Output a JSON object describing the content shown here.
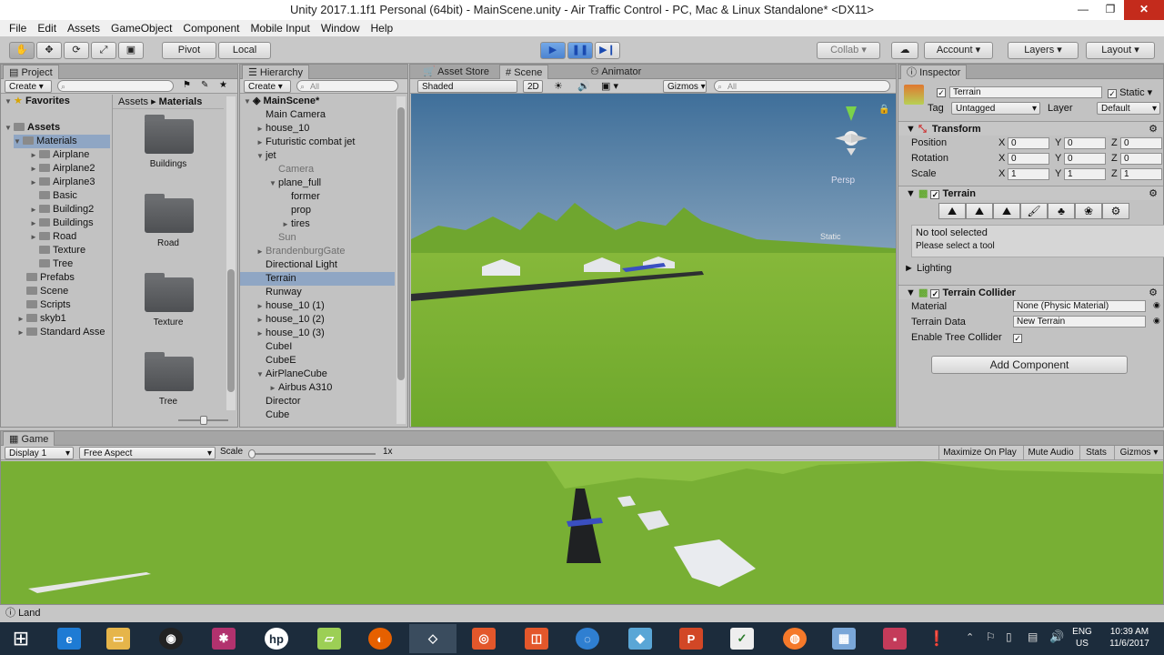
{
  "window": {
    "title": "Unity 2017.1.1f1 Personal (64bit) - MainScene.unity - Air Traffic Control - PC, Mac & Linux Standalone* <DX11>"
  },
  "menu": [
    "File",
    "Edit",
    "Assets",
    "GameObject",
    "Component",
    "Mobile Input",
    "Window",
    "Help"
  ],
  "toolbar": {
    "pivot": "Pivot",
    "local": "Local",
    "collab": "Collab",
    "account": "Account",
    "layers": "Layers",
    "layout": "Layout"
  },
  "project": {
    "tab": "Project",
    "create": "Create",
    "favorites": "Favorites",
    "assets": "Assets",
    "breadcrumb_root": "Assets",
    "breadcrumb_leaf": "Materials",
    "tree": [
      {
        "label": "Materials",
        "depth": 1,
        "arrow": "▼",
        "selected": true
      },
      {
        "label": "Airplane",
        "depth": 2,
        "arrow": "►"
      },
      {
        "label": "Airplane2",
        "depth": 2,
        "arrow": "►"
      },
      {
        "label": "Airplane3",
        "depth": 2,
        "arrow": "►"
      },
      {
        "label": "Basic",
        "depth": 2,
        "arrow": ""
      },
      {
        "label": "Building2",
        "depth": 2,
        "arrow": "►"
      },
      {
        "label": "Buildings",
        "depth": 2,
        "arrow": "►"
      },
      {
        "label": "Road",
        "depth": 2,
        "arrow": "►"
      },
      {
        "label": "Texture",
        "depth": 2,
        "arrow": ""
      },
      {
        "label": "Tree",
        "depth": 2,
        "arrow": ""
      },
      {
        "label": "Prefabs",
        "depth": 1,
        "arrow": ""
      },
      {
        "label": "Scene",
        "depth": 1,
        "arrow": ""
      },
      {
        "label": "Scripts",
        "depth": 1,
        "arrow": ""
      },
      {
        "label": "skyb1",
        "depth": 1,
        "arrow": "►"
      },
      {
        "label": "Standard Asse",
        "depth": 1,
        "arrow": "►"
      }
    ],
    "folders": [
      "Buildings",
      "Road",
      "Texture",
      "Tree"
    ]
  },
  "hierarchy": {
    "tab": "Hierarchy",
    "create": "Create",
    "search": "All",
    "scene": "MainScene*",
    "items": [
      {
        "label": "Main Camera",
        "depth": 1,
        "arrow": ""
      },
      {
        "label": "house_10",
        "depth": 1,
        "arrow": "►"
      },
      {
        "label": "Futuristic combat jet",
        "depth": 1,
        "arrow": "►"
      },
      {
        "label": "jet",
        "depth": 1,
        "arrow": "▼"
      },
      {
        "label": "Camera",
        "depth": 2,
        "arrow": "",
        "dim": true
      },
      {
        "label": "plane_full",
        "depth": 2,
        "arrow": "▼"
      },
      {
        "label": "former",
        "depth": 3,
        "arrow": ""
      },
      {
        "label": "prop",
        "depth": 3,
        "arrow": ""
      },
      {
        "label": "tires",
        "depth": 3,
        "arrow": "►"
      },
      {
        "label": "Sun",
        "depth": 2,
        "arrow": "",
        "dim": true
      },
      {
        "label": "BrandenburgGate",
        "depth": 1,
        "arrow": "►",
        "dim": true
      },
      {
        "label": "Directional Light",
        "depth": 1,
        "arrow": ""
      },
      {
        "label": "Terrain",
        "depth": 1,
        "arrow": "",
        "selected": true
      },
      {
        "label": "Runway",
        "depth": 1,
        "arrow": ""
      },
      {
        "label": "house_10 (1)",
        "depth": 1,
        "arrow": "►"
      },
      {
        "label": "house_10 (2)",
        "depth": 1,
        "arrow": "►"
      },
      {
        "label": "house_10 (3)",
        "depth": 1,
        "arrow": "►"
      },
      {
        "label": "CubeI",
        "depth": 1,
        "arrow": ""
      },
      {
        "label": "CubeE",
        "depth": 1,
        "arrow": ""
      },
      {
        "label": "AirPlaneCube",
        "depth": 1,
        "arrow": "▼"
      },
      {
        "label": "Airbus A310",
        "depth": 2,
        "arrow": "►"
      },
      {
        "label": "Director",
        "depth": 1,
        "arrow": ""
      },
      {
        "label": "Cube",
        "depth": 1,
        "arrow": ""
      }
    ]
  },
  "scene": {
    "tabs": [
      "Asset Store",
      "Scene",
      "Animator"
    ],
    "shading": "Shaded",
    "mode2d": "2D",
    "gizmos": "Gizmos",
    "search": "All",
    "persp": "Persp",
    "static_label": "Static"
  },
  "inspector": {
    "tab": "Inspector",
    "object_name": "Terrain",
    "static": "Static",
    "tag_label": "Tag",
    "tag": "Untagged",
    "layer_label": "Layer",
    "layer": "Default",
    "transform": {
      "title": "Transform",
      "rows": [
        {
          "label": "Position",
          "x": "0",
          "y": "0",
          "z": "0"
        },
        {
          "label": "Rotation",
          "x": "0",
          "y": "0",
          "z": "0"
        },
        {
          "label": "Scale",
          "x": "1",
          "y": "1",
          "z": "1"
        }
      ]
    },
    "terrain": {
      "title": "Terrain",
      "msg1": "No tool selected",
      "msg2": "Please select a tool",
      "tools": [
        "⛰",
        "⛰",
        "⛰",
        "🖌",
        "♣",
        "❀",
        "⚙"
      ]
    },
    "lighting": "Lighting",
    "collider": {
      "title": "Terrain Collider",
      "material_label": "Material",
      "material": "None (Physic Material)",
      "data_label": "Terrain Data",
      "data": "New Terrain",
      "tree_label": "Enable Tree Collider"
    },
    "add_component": "Add Component"
  },
  "game": {
    "tab": "Game",
    "display": "Display 1",
    "aspect": "Free Aspect",
    "scale_label": "Scale",
    "scale_value": "1x",
    "maximize": "Maximize On Play",
    "mute": "Mute Audio",
    "stats": "Stats",
    "gizmos": "Gizmos"
  },
  "status": {
    "text": "Land"
  },
  "taskbar": {
    "lang1": "ENG",
    "lang2": "US",
    "time": "10:39 AM",
    "date": "11/6/2017"
  }
}
